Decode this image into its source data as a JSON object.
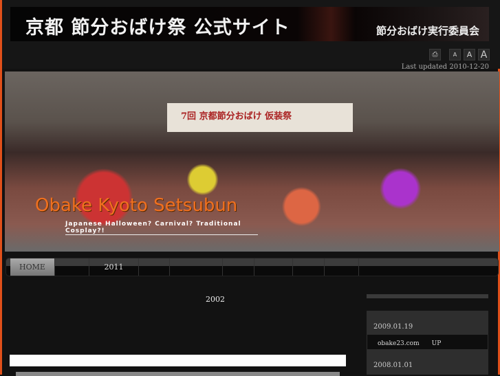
{
  "header": {
    "title": "京都 節分おばけ祭 公式サイト",
    "organizer": "節分おばけ実行委員会"
  },
  "toolbar": {
    "print_icon": "printer-icon",
    "font_small": "A",
    "font_medium": "A",
    "font_large": "A",
    "last_updated": "Last updated 2010-12-20"
  },
  "hero": {
    "sign": "7回 京都節分おばけ 仮装祭",
    "title": "Obake Kyoto Setsubun",
    "subtitle": "Japanese Halloween? Carnival? Traditional Cosplay?!"
  },
  "nav": {
    "items": [
      "HOME",
      "",
      "2011",
      "",
      "",
      "",
      "",
      "",
      "",
      ""
    ]
  },
  "main": {
    "year": "2002"
  },
  "sidebar": {
    "news": [
      {
        "date": "2009.01.19",
        "text": "obake23.com　　UP"
      },
      {
        "date": "2008.01.01"
      }
    ]
  }
}
